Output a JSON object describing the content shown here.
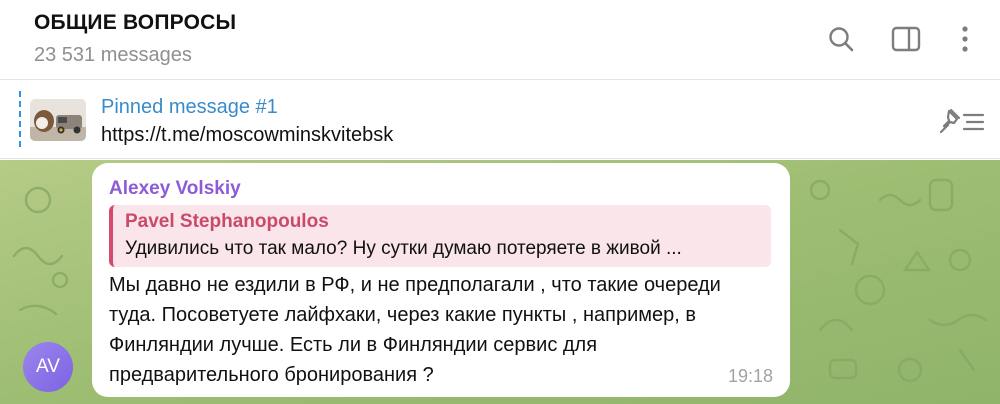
{
  "header": {
    "title": "ОБЩИЕ ВОПРОСЫ",
    "subtitle": "23 531 messages",
    "icons": [
      "search-icon",
      "sidebar-toggle-icon",
      "more-icon"
    ]
  },
  "pinned": {
    "title": "Pinned message #1",
    "text": "https://t.me/moscowminskvitebsk",
    "accent": "#3390ec"
  },
  "message": {
    "avatar_initials": "AV",
    "sender": "Alexey Volskiy",
    "reply_name": "Pavel Stephanopoulos",
    "reply_text": "Удивились что так мало? Ну сутки думаю потеряете в живой ...",
    "lines": [
      "Мы давно не ездили в РФ, и не предполагали , что такие очереди",
      "туда. Посоветуете лайфхаки, через какие пункты , например, в",
      "Финляндии лучше. Есть ли в Финляндии сервис для",
      "предварительного бронирования ?"
    ],
    "time": "19:18"
  },
  "colors": {
    "chat_background": "#a5c27a",
    "sender_name": "#8e5bd6",
    "reply_accent": "#d54b6e",
    "reply_background": "#f9e5ea",
    "avatar": "#8a72e8"
  }
}
